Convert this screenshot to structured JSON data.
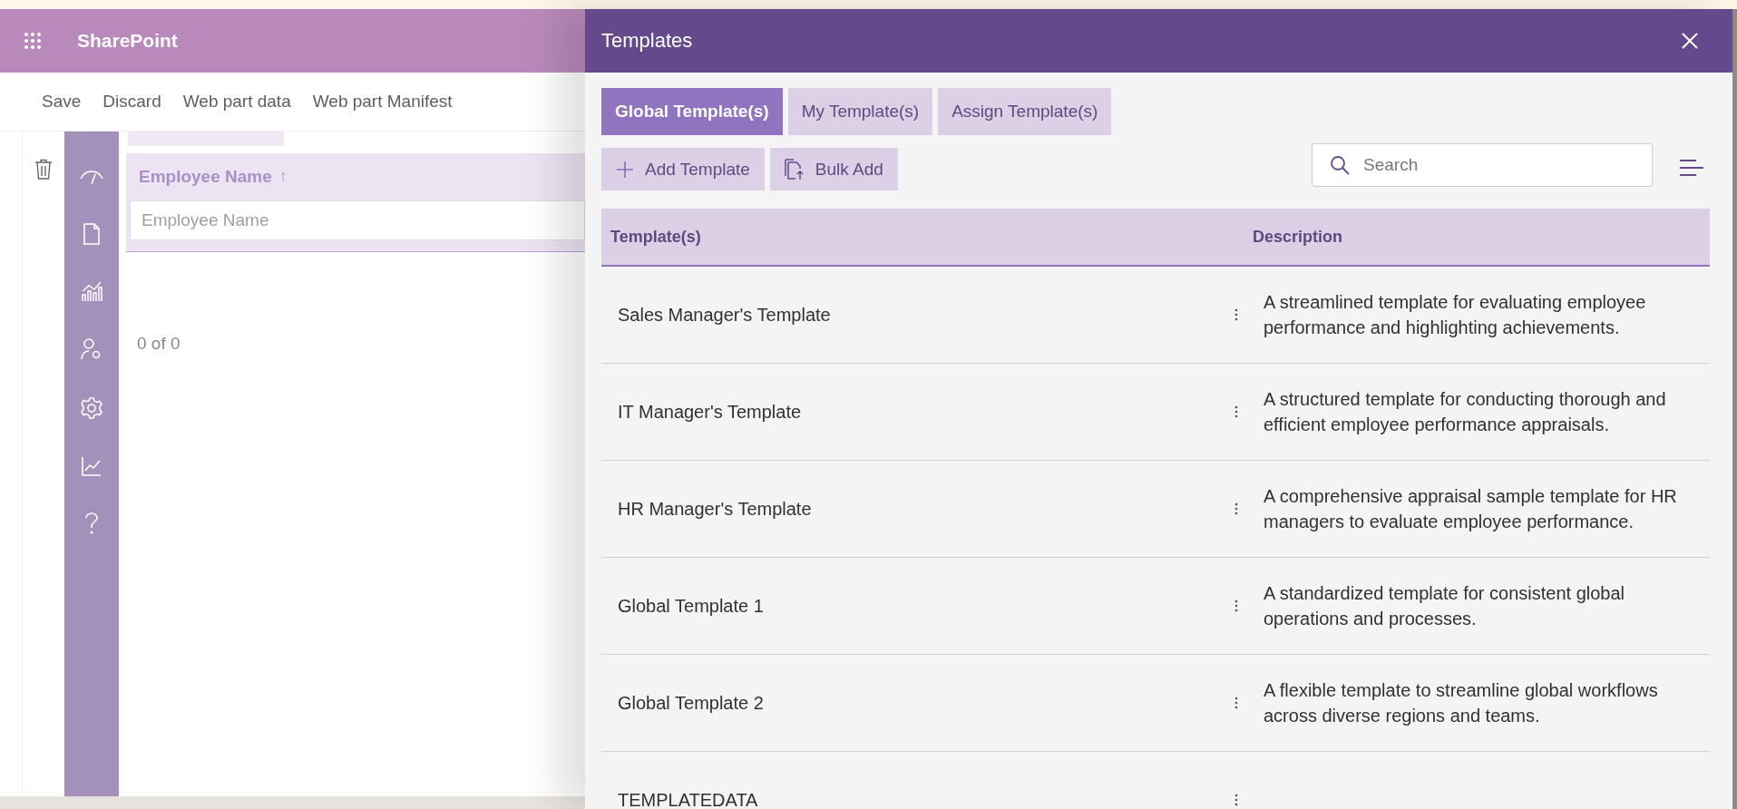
{
  "app": {
    "title": "SharePoint"
  },
  "command_bar": [
    "Save",
    "Discard",
    "Web part data",
    "Web part Manifest"
  ],
  "grid": {
    "column": "Employee Name",
    "sort_arrow": "↑",
    "filter_placeholder": "Employee Name",
    "count": "0 of 0"
  },
  "panel": {
    "title": "Templates",
    "tabs": [
      {
        "label": "Global Template(s)",
        "selected": true
      },
      {
        "label": "My Template(s)",
        "selected": false
      },
      {
        "label": "Assign Template(s)",
        "selected": false
      }
    ],
    "actions": [
      {
        "kind": "add",
        "label": "Add Template"
      },
      {
        "kind": "bulk",
        "label": "Bulk Add"
      }
    ],
    "search": {
      "placeholder": "Search"
    },
    "columns": [
      "Template(s)",
      "Description"
    ],
    "rows": [
      {
        "name": "Sales Manager's Template",
        "description": "A streamlined template for evaluating employee performance and highlighting achievements."
      },
      {
        "name": "IT Manager's Template",
        "description": "A structured template for conducting thorough and efficient employee performance appraisals."
      },
      {
        "name": "HR Manager's Template",
        "description": "A comprehensive appraisal sample template for HR managers to evaluate employee performance."
      },
      {
        "name": "Global Template 1",
        "description": "A standardized template for consistent global operations and processes."
      },
      {
        "name": "Global Template 2",
        "description": "A flexible template to streamline global workflows across diverse regions and teams."
      },
      {
        "name": "TEMPLATEDATA",
        "description": ""
      }
    ]
  }
}
